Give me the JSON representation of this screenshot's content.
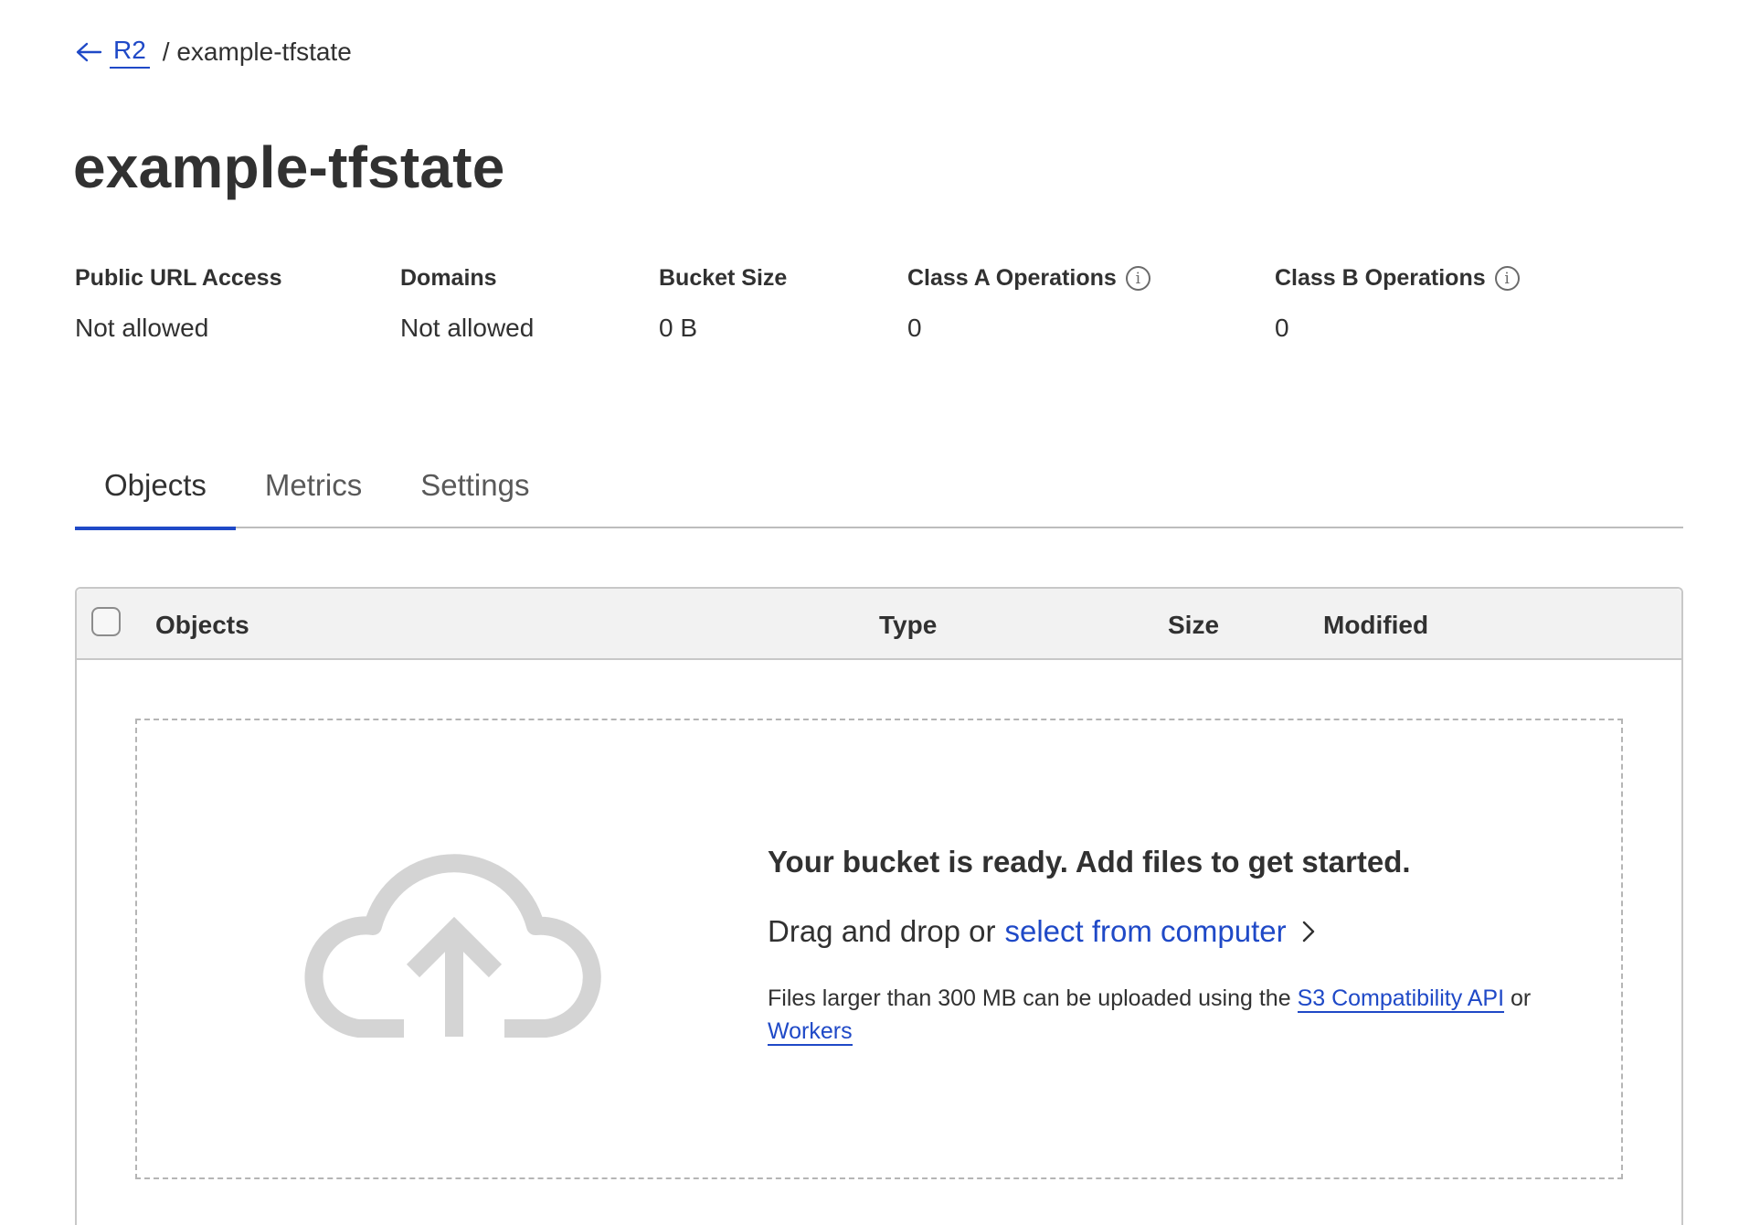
{
  "breadcrumb": {
    "back_label": "R2",
    "current": "/ example-tfstate"
  },
  "page_title": "example-tfstate",
  "stats": [
    {
      "label": "Public URL Access",
      "value": "Not allowed"
    },
    {
      "label": "Domains",
      "value": "Not allowed"
    },
    {
      "label": "Bucket Size",
      "value": "0 B"
    },
    {
      "label": "Class A Operations",
      "value": "0"
    },
    {
      "label": "Class B Operations",
      "value": "0"
    }
  ],
  "tabs": [
    {
      "label": "Objects",
      "active": true
    },
    {
      "label": "Metrics",
      "active": false
    },
    {
      "label": "Settings",
      "active": false
    }
  ],
  "table": {
    "columns": [
      "Objects",
      "Type",
      "Size",
      "Modified"
    ],
    "select_all_checked": false
  },
  "dropzone": {
    "heading": "Your bucket is ready. Add files to get started.",
    "drag_text": "Drag and drop or",
    "select_link": "select from computer",
    "note_prefix": "Files larger than 300 MB can be uploaded using the",
    "s3_link": "S3 Compatibility API",
    "note_or": "or",
    "workers_link": "Workers"
  },
  "colors": {
    "accent": "#1f49c7",
    "text": "#313131",
    "icon_gray": "#d4d4d4"
  },
  "icons": {
    "back": "arrow-left-icon",
    "info": "info-icon",
    "upload": "cloud-upload-icon",
    "chevron": "chevron-right-icon"
  }
}
